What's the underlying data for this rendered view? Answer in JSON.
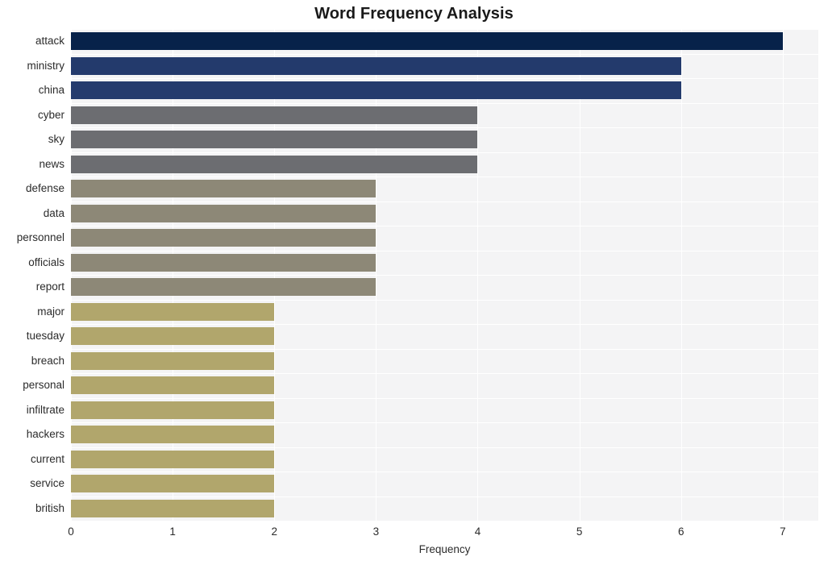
{
  "chart_data": {
    "type": "bar",
    "orientation": "horizontal",
    "title": "Word Frequency Analysis",
    "xlabel": "Frequency",
    "ylabel": "",
    "categories": [
      "attack",
      "ministry",
      "china",
      "cyber",
      "sky",
      "news",
      "defense",
      "data",
      "personnel",
      "officials",
      "report",
      "major",
      "tuesday",
      "breach",
      "personal",
      "infiltrate",
      "hackers",
      "current",
      "service",
      "british"
    ],
    "values": [
      7,
      6,
      6,
      4,
      4,
      4,
      3,
      3,
      3,
      3,
      3,
      2,
      2,
      2,
      2,
      2,
      2,
      2,
      2,
      2
    ],
    "bar_colors": [
      "#07224a",
      "#233a6c",
      "#243b6d",
      "#6c6d71",
      "#6c6d71",
      "#6c6d71",
      "#8d8877",
      "#8d8877",
      "#8d8877",
      "#8d8877",
      "#8d8877",
      "#b1a66c",
      "#b1a66c",
      "#b1a66c",
      "#b1a66c",
      "#b1a66c",
      "#b1a66c",
      "#b1a66c",
      "#b1a66c",
      "#b1a66c"
    ],
    "xlim": [
      0,
      7.35
    ],
    "xticks": [
      0,
      1,
      2,
      3,
      4,
      5,
      6,
      7
    ],
    "xtick_labels": [
      "0",
      "1",
      "2",
      "3",
      "4",
      "5",
      "6",
      "7"
    ],
    "grid": "vertical-and-horizontal-white-on-gray",
    "legend": "none",
    "plot_background": "#f4f4f5",
    "figure_background": "#ffffff",
    "title_color": "#1a1a1a",
    "tick_color": "#2b2b2b"
  }
}
